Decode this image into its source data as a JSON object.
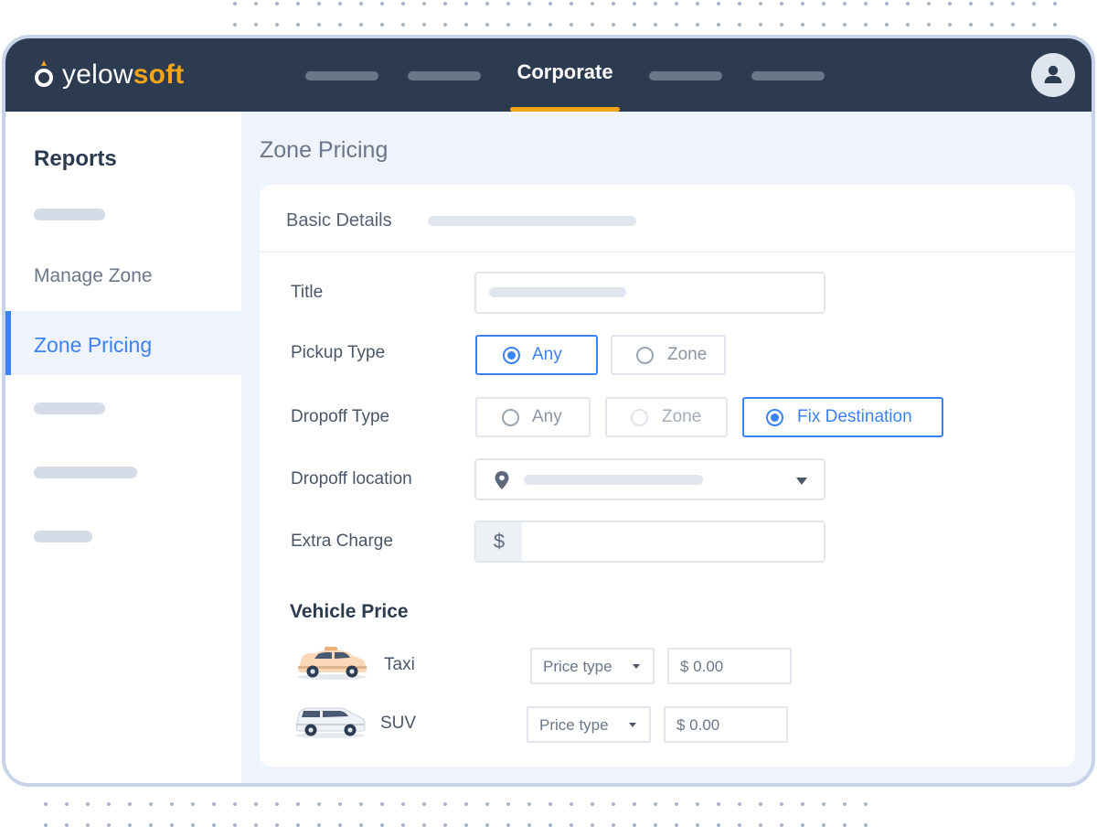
{
  "brand": {
    "name_part1": "yelow",
    "name_part2": "soft"
  },
  "header": {
    "active_nav": "Corporate"
  },
  "sidebar": {
    "title": "Reports",
    "manage_zone": "Manage Zone",
    "active_item": "Zone Pricing"
  },
  "page": {
    "title": "Zone Pricing"
  },
  "form": {
    "section_title": "Basic Details",
    "title_label": "Title",
    "pickup_label": "Pickup Type",
    "pickup_options": [
      {
        "label": "Any",
        "selected": true
      },
      {
        "label": "Zone",
        "selected": false
      }
    ],
    "dropoff_label": "Dropoff Type",
    "dropoff_options": [
      {
        "label": "Any",
        "selected": false
      },
      {
        "label": "Zone",
        "selected": false
      },
      {
        "label": "Fix Destination",
        "selected": true
      }
    ],
    "location_label": "Dropoff location",
    "extra_label": "Extra Charge",
    "currency_symbol": "$"
  },
  "vehicle_price": {
    "title": "Vehicle Price",
    "vehicles": [
      {
        "name": "Taxi",
        "price_type": "Price type",
        "amount": "$ 0.00"
      },
      {
        "name": "SUV",
        "price_type": "Price type",
        "amount": "$ 0.00"
      }
    ]
  },
  "colors": {
    "topbar": "#2c3b50",
    "accent": "#f4a518",
    "selected": "#3b82f6",
    "background": "#eef3fc"
  },
  "icons": [
    "logo-mark-icon",
    "user-icon",
    "map-pin-icon",
    "caret-down-icon",
    "taxi-car-icon",
    "suv-car-icon",
    "radio-icon"
  ]
}
